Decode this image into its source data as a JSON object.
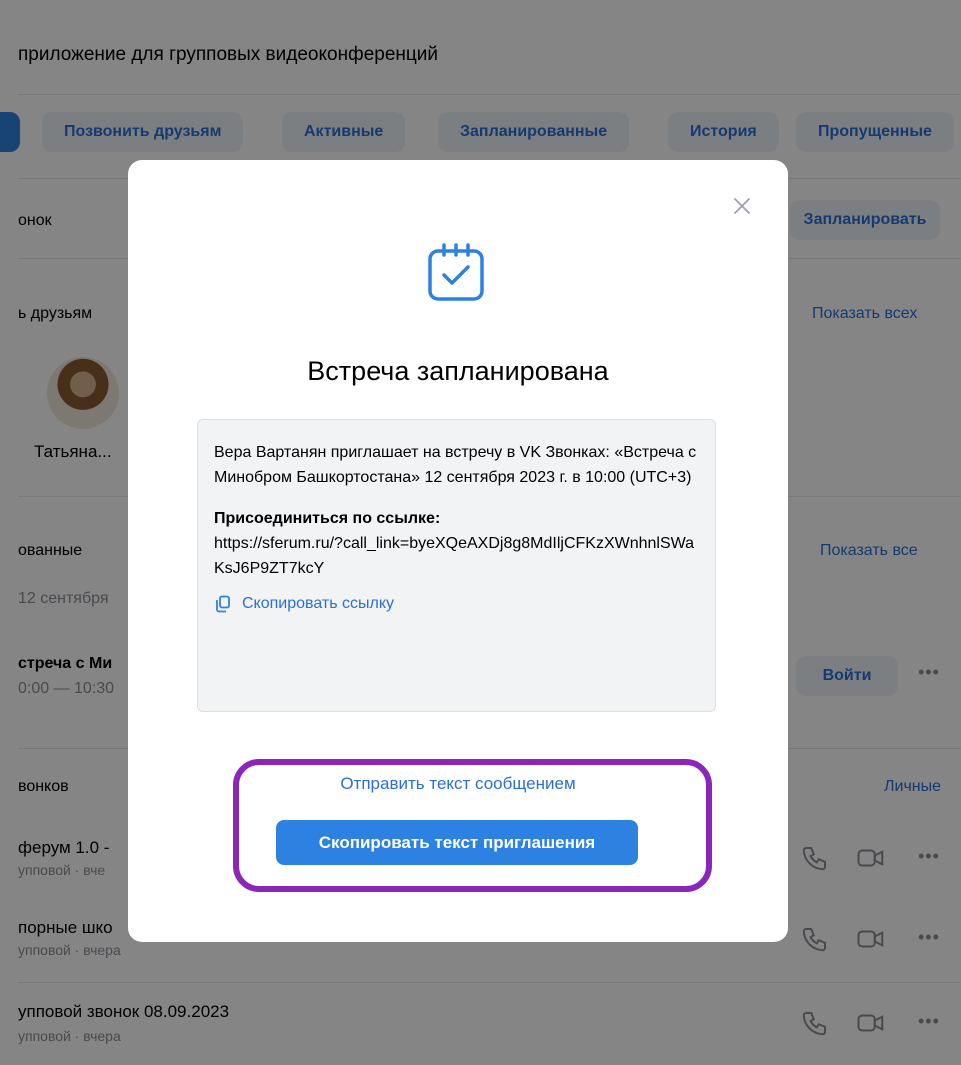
{
  "app": {
    "subtitle": "приложение для групповых видеоконференций",
    "tabs": [
      "Позвонить друзьям",
      "Активные",
      "Запланированные",
      "История",
      "Пропущенные"
    ],
    "call_row_label": "онок",
    "schedule_button": "Запланировать",
    "friends_section": {
      "label": "ь друзьям",
      "show_all": "Показать всех"
    },
    "friend": {
      "name": "Татьяна..."
    },
    "planned_section": {
      "label": "ованные",
      "show_all": "Показать все",
      "date": "12 сентября"
    },
    "planned_item": {
      "title": "стреча с Ми",
      "time": "0:00 — 10:30",
      "join": "Войти"
    },
    "history_section": {
      "label": "вонков",
      "filter": "Личные"
    },
    "history_items": [
      {
        "title": "ферум 1.0 - ",
        "sub": "упповой · вче"
      },
      {
        "title": "порные шко",
        "sub": "упповой · вчера"
      },
      {
        "title": "упповой звонок 08.09.2023",
        "sub": "упповой · вчера"
      }
    ]
  },
  "modal": {
    "title": "Встреча запланирована",
    "invite_text": "Вера Вартанян приглашает на встречу в VK Звонках: «Встреча с Минобром Башкортостана» 12 сентября 2023 г. в 10:00 (UTC+3)",
    "join_label": "Присоединиться по ссылке:",
    "join_link": "https://sferum.ru/?call_link=byeXQeAXDj8g8MdIljCFKzXWnhnlSWaKsJ6P9ZT7kcY",
    "copy_link": "Скопировать ссылку",
    "send_text": "Отправить текст сообщением",
    "copy_invite": "Скопировать текст приглашения"
  },
  "colors": {
    "accent": "#2d81e0",
    "link": "#2a6fd6",
    "highlight": "#8c26bb",
    "infobox_bg": "#f2f3f5"
  },
  "icons": [
    "close-icon",
    "calendar-check-icon",
    "copy-icon",
    "phone-icon",
    "video-icon",
    "more-icon"
  ]
}
